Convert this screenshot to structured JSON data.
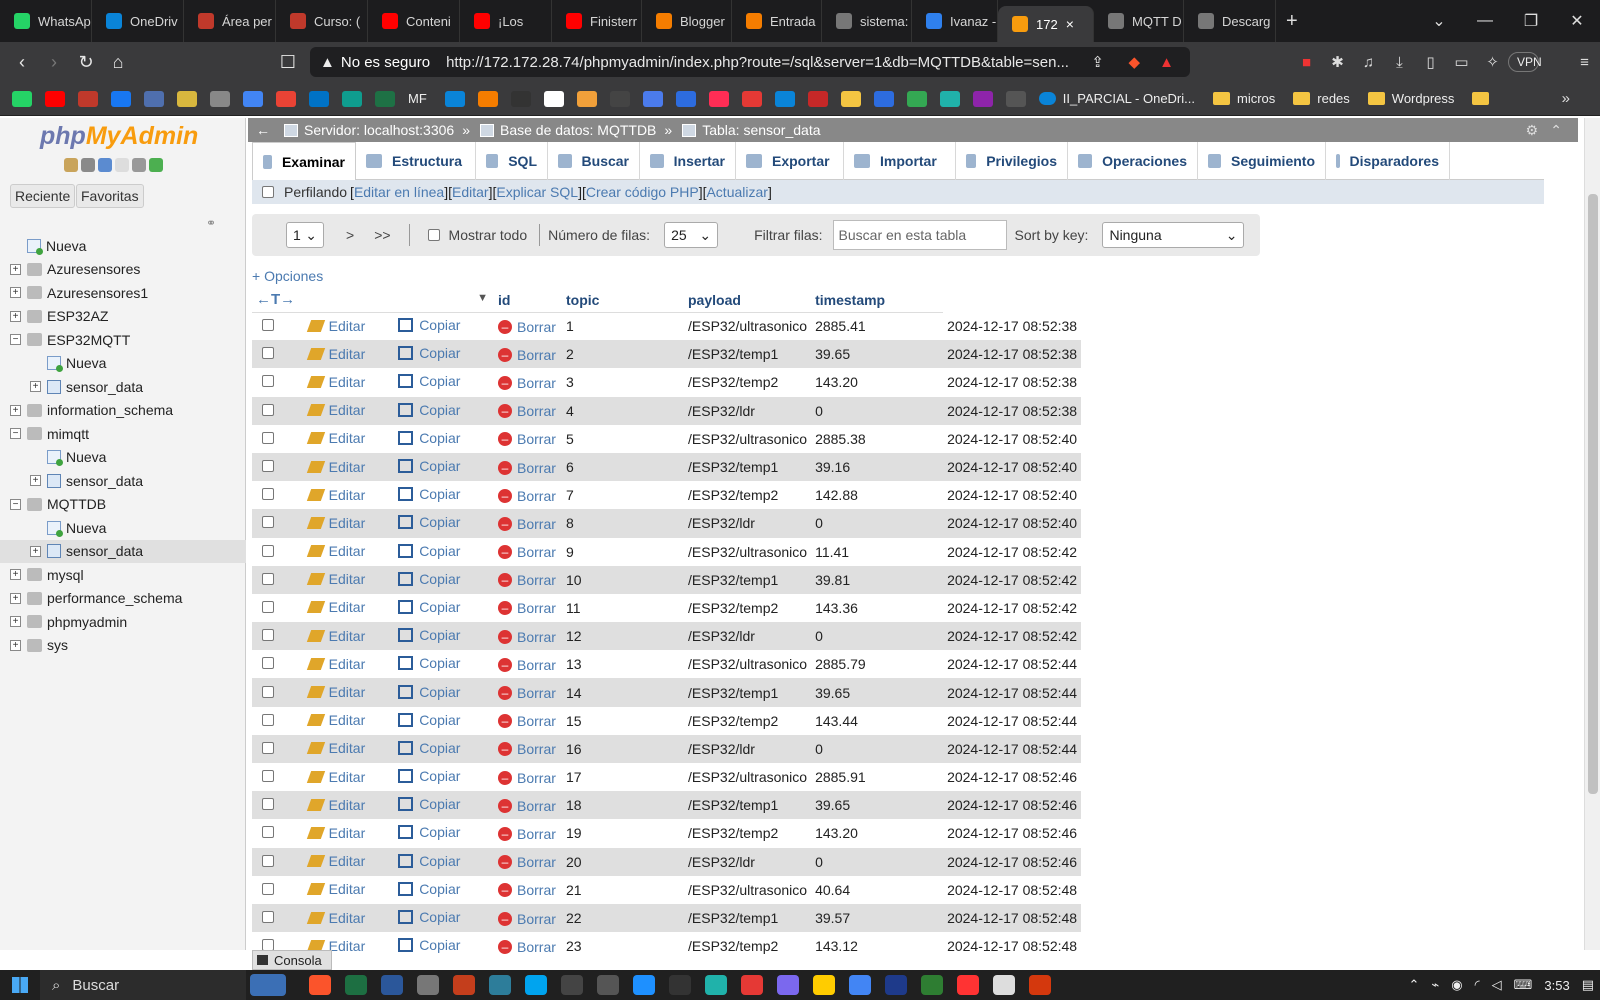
{
  "browser": {
    "tabs": [
      {
        "label": "WhatsAp",
        "color": "#25d366"
      },
      {
        "label": "OneDriv",
        "color": "#0a84d8"
      },
      {
        "label": "Área per",
        "color": "#c0392b"
      },
      {
        "label": "Curso: (",
        "color": "#c0392b"
      },
      {
        "label": "Conteni",
        "color": "#ff0000"
      },
      {
        "label": "¡Los",
        "color": "#ff0000"
      },
      {
        "label": "Finisterr",
        "color": "#ff0000"
      },
      {
        "label": "Blogger",
        "color": "#f57d00"
      },
      {
        "label": "Entrada",
        "color": "#f57d00"
      },
      {
        "label": "sistema:",
        "color": "#777777"
      },
      {
        "label": "Ivanaz -",
        "color": "#2f80ed"
      },
      {
        "label": "172",
        "color": "#f89c0e"
      },
      {
        "label": "MQTT D",
        "color": "#777777"
      },
      {
        "label": "Descarg",
        "color": "#777777"
      }
    ],
    "active_tab_close": "×",
    "new_tab": "+",
    "not_secure": "No es seguro",
    "url": "http://172.172.28.74/phpmyadmin/index.php?route=/sql&server=1&db=MQTTDB&table=sen...",
    "vpn": "VPN",
    "bookmarks": [
      {
        "label": "II_PARCIAL - OneDri...",
        "type": "cloud"
      },
      {
        "label": "micros",
        "type": "folder"
      },
      {
        "label": "redes",
        "type": "folder"
      },
      {
        "label": "Wordpress",
        "type": "folder"
      }
    ],
    "bookmark_icon_colors": [
      "#25d366",
      "#ff0000",
      "#c0392b",
      "#1877f2",
      "#4f6fae",
      "#d8b73e",
      "#888888",
      "#4285f4",
      "#ea4335",
      "#0072c6",
      "#0f9d8f",
      "#1e7145",
      "#0a84d8",
      "#f57d00",
      "#333333",
      "#ffffff",
      "#f1a03a",
      "#444444",
      "#4b7bec",
      "#2d6cdf",
      "#ff2d55",
      "#e53935",
      "#0a84d8",
      "#c62828",
      "#f4c542",
      "#2d6cdf",
      "#34a853",
      "#20b2aa",
      "#8e24aa",
      "#555555"
    ],
    "bookmark_text_mf": "MF"
  },
  "pma": {
    "logo_php": "php",
    "logo_ma": "MyAdmin",
    "recent": "Reciente",
    "favorites": "Favoritas",
    "tree": [
      {
        "label": "Nueva",
        "level": 0,
        "kind": "new",
        "exp": ""
      },
      {
        "label": "Azuresensores",
        "level": 0,
        "kind": "db",
        "exp": "+"
      },
      {
        "label": "Azuresensores1",
        "level": 0,
        "kind": "db",
        "exp": "+"
      },
      {
        "label": "ESP32AZ",
        "level": 0,
        "kind": "db",
        "exp": "+"
      },
      {
        "label": "ESP32MQTT",
        "level": 0,
        "kind": "db",
        "exp": "−"
      },
      {
        "label": "Nueva",
        "level": 1,
        "kind": "new",
        "exp": ""
      },
      {
        "label": "sensor_data",
        "level": 1,
        "kind": "table",
        "exp": "+"
      },
      {
        "label": "information_schema",
        "level": 0,
        "kind": "db",
        "exp": "+"
      },
      {
        "label": "mimqtt",
        "level": 0,
        "kind": "db",
        "exp": "−"
      },
      {
        "label": "Nueva",
        "level": 1,
        "kind": "new",
        "exp": ""
      },
      {
        "label": "sensor_data",
        "level": 1,
        "kind": "table",
        "exp": "+"
      },
      {
        "label": "MQTTDB",
        "level": 0,
        "kind": "db",
        "exp": "−"
      },
      {
        "label": "Nueva",
        "level": 1,
        "kind": "new",
        "exp": ""
      },
      {
        "label": "sensor_data",
        "level": 1,
        "kind": "table",
        "exp": "+",
        "selected": true
      },
      {
        "label": "mysql",
        "level": 0,
        "kind": "db",
        "exp": "+"
      },
      {
        "label": "performance_schema",
        "level": 0,
        "kind": "db",
        "exp": "+"
      },
      {
        "label": "phpmyadmin",
        "level": 0,
        "kind": "db",
        "exp": "+"
      },
      {
        "label": "sys",
        "level": 0,
        "kind": "db",
        "exp": "+"
      }
    ],
    "breadcrumb": {
      "server": "Servidor: localhost:3306",
      "db": "Base de datos: MQTTDB",
      "table": "Tabla: sensor_data",
      "sep": "»"
    },
    "tabs": [
      "Examinar",
      "Estructura",
      "SQL",
      "Buscar",
      "Insertar",
      "Exportar",
      "Importar",
      "Privilegios",
      "Operaciones",
      "Seguimiento",
      "Disparadores"
    ],
    "sqlbar": {
      "profiling": "Perfilando",
      "links": [
        "Editar en línea",
        "Editar",
        "Explicar SQL",
        "Crear código PHP",
        "Actualizar"
      ]
    },
    "nav": {
      "page": "1",
      "next": ">",
      "last": ">>",
      "show_all": "Mostrar todo",
      "rows_label": "Número de filas:",
      "rows_value": "25",
      "filter_label": "Filtrar filas:",
      "filter_placeholder": "Buscar en esta tabla",
      "sort_label": "Sort by key:",
      "sort_value": "Ninguna"
    },
    "options": "+ Opciones",
    "columns": [
      "id",
      "topic",
      "payload",
      "timestamp"
    ],
    "col_arrows": "←T→",
    "actions": {
      "edit": "Editar",
      "copy": "Copiar",
      "delete": "Borrar"
    },
    "rows": [
      [
        "1",
        "/ESP32/ultrasonico",
        "2885.41",
        "2024-12-17 08:52:38"
      ],
      [
        "2",
        "/ESP32/temp1",
        "39.65",
        "2024-12-17 08:52:38"
      ],
      [
        "3",
        "/ESP32/temp2",
        "143.20",
        "2024-12-17 08:52:38"
      ],
      [
        "4",
        "/ESP32/ldr",
        "0",
        "2024-12-17 08:52:38"
      ],
      [
        "5",
        "/ESP32/ultrasonico",
        "2885.38",
        "2024-12-17 08:52:40"
      ],
      [
        "6",
        "/ESP32/temp1",
        "39.16",
        "2024-12-17 08:52:40"
      ],
      [
        "7",
        "/ESP32/temp2",
        "142.88",
        "2024-12-17 08:52:40"
      ],
      [
        "8",
        "/ESP32/ldr",
        "0",
        "2024-12-17 08:52:40"
      ],
      [
        "9",
        "/ESP32/ultrasonico",
        "11.41",
        "2024-12-17 08:52:42"
      ],
      [
        "10",
        "/ESP32/temp1",
        "39.81",
        "2024-12-17 08:52:42"
      ],
      [
        "11",
        "/ESP32/temp2",
        "143.36",
        "2024-12-17 08:52:42"
      ],
      [
        "12",
        "/ESP32/ldr",
        "0",
        "2024-12-17 08:52:42"
      ],
      [
        "13",
        "/ESP32/ultrasonico",
        "2885.79",
        "2024-12-17 08:52:44"
      ],
      [
        "14",
        "/ESP32/temp1",
        "39.65",
        "2024-12-17 08:52:44"
      ],
      [
        "15",
        "/ESP32/temp2",
        "143.44",
        "2024-12-17 08:52:44"
      ],
      [
        "16",
        "/ESP32/ldr",
        "0",
        "2024-12-17 08:52:44"
      ],
      [
        "17",
        "/ESP32/ultrasonico",
        "2885.91",
        "2024-12-17 08:52:46"
      ],
      [
        "18",
        "/ESP32/temp1",
        "39.65",
        "2024-12-17 08:52:46"
      ],
      [
        "19",
        "/ESP32/temp2",
        "143.20",
        "2024-12-17 08:52:46"
      ],
      [
        "20",
        "/ESP32/ldr",
        "0",
        "2024-12-17 08:52:46"
      ],
      [
        "21",
        "/ESP32/ultrasonico",
        "40.64",
        "2024-12-17 08:52:48"
      ],
      [
        "22",
        "/ESP32/temp1",
        "39.57",
        "2024-12-17 08:52:48"
      ],
      [
        "23",
        "/ESP32/temp2",
        "143.12",
        "2024-12-17 08:52:48"
      ]
    ],
    "console": "Consola"
  },
  "taskbar": {
    "search": "Buscar",
    "apps": [
      "#fb542b",
      "#1d6f42",
      "#2b579a",
      "#777777",
      "#c43e1c",
      "#2d7d9a",
      "#00a4ef",
      "#444444",
      "#555555",
      "#1e90ff",
      "#333333",
      "#20b2aa",
      "#e53935",
      "#7b68ee",
      "#ffcc00",
      "#4285f4",
      "#1e3a8a",
      "#2e7d32",
      "#ff3333",
      "#dddddd",
      "#d4380d"
    ],
    "time": "3:53"
  }
}
